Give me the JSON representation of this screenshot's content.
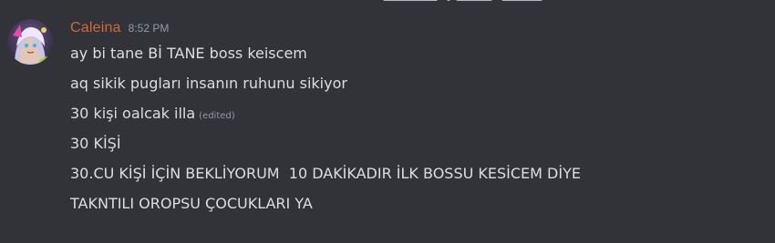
{
  "message": {
    "author": "Caleina",
    "timestamp": "8:52 PM",
    "author_color": "#d4683b",
    "avatar": "avatar-image",
    "edited_label": "(edited)",
    "lines": [
      "ay bi tane Bİ TANE boss keiscem",
      "aq sikik pugları insanın ruhunu sikiyor",
      "30 kişi oalcak illa",
      "30 KİŞİ",
      "30.CU KİŞİ İÇİN BEKLİYORUM  10 DAKİKADIR İLK BOSSU KESİCEM DİYE",
      "TAKNTILI OROPSU ÇOCUKLARI YA"
    ]
  },
  "colors": {
    "background": "#313338",
    "text": "#dbdee1",
    "muted": "#949ba4"
  }
}
